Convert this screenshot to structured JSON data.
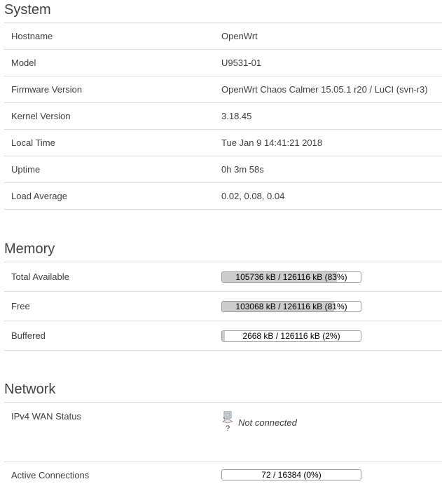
{
  "system": {
    "title": "System",
    "rows": [
      {
        "key": "Hostname",
        "value": "OpenWrt"
      },
      {
        "key": "Model",
        "value": "U9531-01"
      },
      {
        "key": "Firmware Version",
        "value": "OpenWrt Chaos Calmer 15.05.1 r20 / LuCI (svn-r3)"
      },
      {
        "key": "Kernel Version",
        "value": "3.18.45"
      },
      {
        "key": "Local Time",
        "value": "Tue Jan 9 14:41:21 2018"
      },
      {
        "key": "Uptime",
        "value": "0h 3m 58s"
      },
      {
        "key": "Load Average",
        "value": "0.02, 0.08, 0.04"
      }
    ]
  },
  "memory": {
    "title": "Memory",
    "rows": [
      {
        "key": "Total Available",
        "bar_text": "105736 kB / 126116 kB (83%)",
        "percent": 83
      },
      {
        "key": "Free",
        "bar_text": "103068 kB / 126116 kB (81%)",
        "percent": 81
      },
      {
        "key": "Buffered",
        "bar_text": "2668 kB / 126116 kB (2%)",
        "percent": 2
      }
    ]
  },
  "network": {
    "title": "Network",
    "wan": {
      "key": "IPv4 WAN Status",
      "icon": "network-disconnected-icon",
      "icon_mark": "?",
      "status": "Not connected"
    },
    "connections": {
      "key": "Active Connections",
      "bar_text": "72 / 16384 (0%)",
      "percent": 0
    }
  },
  "colors": {
    "bar_fill": "#cccccc",
    "bar_border": "#999999",
    "divider": "#dddddd",
    "text": "#404040"
  }
}
